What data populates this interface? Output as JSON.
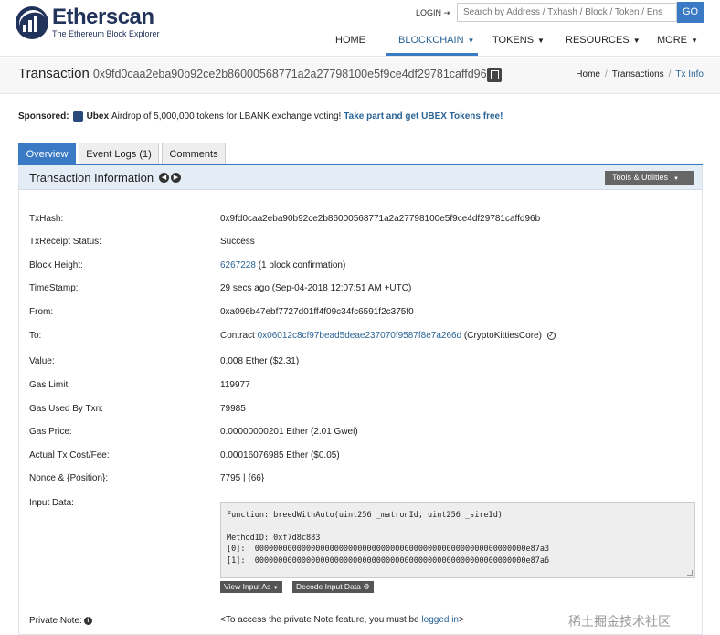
{
  "brand": {
    "name": "Etherscan",
    "tagline": "The Ethereum Block Explorer"
  },
  "header": {
    "login_label": "LOGIN",
    "search_placeholder": "Search by Address / Txhash / Block / Token / Ens",
    "go_label": "GO"
  },
  "nav": {
    "items": [
      {
        "label": "HOME"
      },
      {
        "label": "BLOCKCHAIN"
      },
      {
        "label": "TOKENS"
      },
      {
        "label": "RESOURCES"
      },
      {
        "label": "MORE"
      }
    ],
    "active": "BLOCKCHAIN"
  },
  "page": {
    "title": "Transaction",
    "tx_hash": "0x9fd0caa2eba90b92ce2b86000568771a2a27798100e5f9ce4df29781caffd96b",
    "breadcrumb": [
      "Home",
      "Transactions",
      "Tx Info"
    ]
  },
  "sponsor": {
    "label": "Sponsored:",
    "brand": "Ubex",
    "text": "Airdrop of 5,000,000 tokens for LBANK exchange voting!",
    "cta": "Take part and get UBEX Tokens free!"
  },
  "tabs": [
    {
      "label": "Overview"
    },
    {
      "label": "Event Logs (1)"
    },
    {
      "label": "Comments"
    }
  ],
  "panel": {
    "title": "Transaction Information",
    "tools_label": "Tools & Utilities"
  },
  "details": {
    "txhash": {
      "label": "TxHash:",
      "value": "0x9fd0caa2eba90b92ce2b86000568771a2a27798100e5f9ce4df29781caffd96b"
    },
    "status": {
      "label": "TxReceipt Status:",
      "value": "Success"
    },
    "block": {
      "label": "Block Height:",
      "value": "6267228",
      "suffix": "(1 block confirmation)"
    },
    "timestamp": {
      "label": "TimeStamp:",
      "value": "29 secs ago (Sep-04-2018 12:07:51 AM +UTC)"
    },
    "from": {
      "label": "From:",
      "value": "0xa096b47ebf7727d01ff4f09c34fc6591f2c375f0"
    },
    "to": {
      "label": "To:",
      "prefix": "Contract",
      "value": "0x06012c8cf97bead5deae237070f9587f8e7a266d",
      "suffix": "(CryptoKittiesCore)"
    },
    "value": {
      "label": "Value:",
      "value": "0.008 Ether ($2.31)"
    },
    "gas_limit": {
      "label": "Gas Limit:",
      "value": "119977"
    },
    "gas_used": {
      "label": "Gas Used By Txn:",
      "value": "79985"
    },
    "gas_price": {
      "label": "Gas Price:",
      "value": "0.00000000201 Ether (2.01 Gwei)"
    },
    "tx_cost": {
      "label": "Actual Tx Cost/Fee:",
      "value": "0.00016076985 Ether ($0.05)"
    },
    "nonce": {
      "label": "Nonce & {Position}:",
      "value": "7795 | {66}"
    },
    "input": {
      "label": "Input Data:",
      "function": "Function: breedWithAuto(uint256 _matronId, uint256 _sireId)",
      "method_id": "MethodID: 0xf7d8c883",
      "param0": "[0]:  0000000000000000000000000000000000000000000000000000000000e87a3",
      "param1": "[1]:  0000000000000000000000000000000000000000000000000000000000e87a6",
      "view_as_label": "View Input As",
      "decode_label": "Decode Input Data"
    },
    "private_note": {
      "label": "Private Note:",
      "text_before": "<To access the private Note feature, you must be",
      "link": "logged in",
      "text_after": ">"
    }
  },
  "watermark": "稀土掘金技术社区"
}
